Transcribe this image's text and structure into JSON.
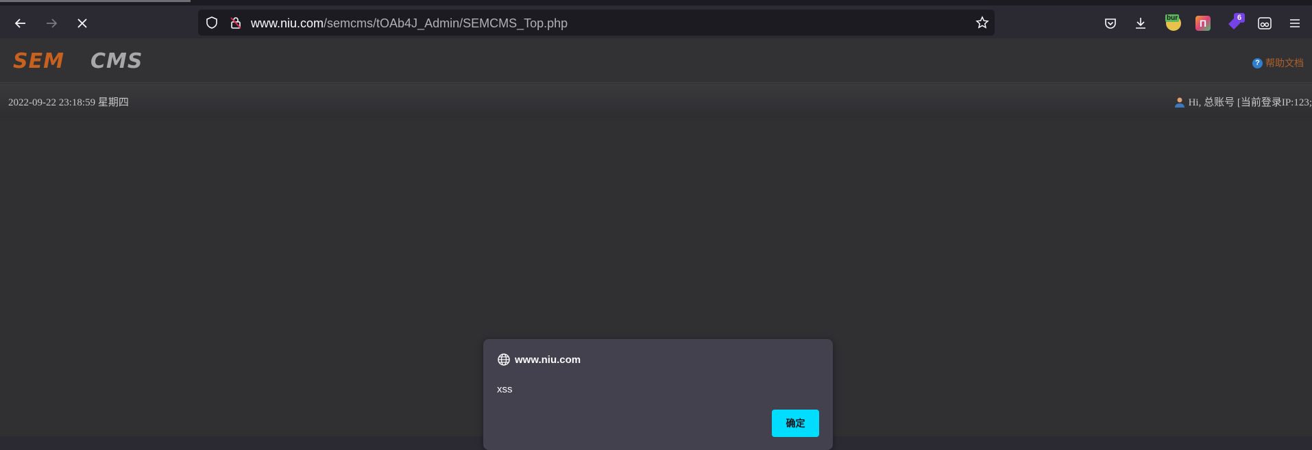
{
  "browser": {
    "url_domain": "www.niu.com",
    "url_path": "/semcms/tOAb4J_Admin/SEMCMS_Top.php",
    "extensions": [
      {
        "name": "bur",
        "color": "#e8c34b"
      },
      {
        "name": "n-ext",
        "color": "#f07a3a"
      },
      {
        "name": "tag-ext",
        "badge": "6",
        "color": "#7542e5"
      },
      {
        "name": "mask-ext",
        "color": "#ffffff"
      }
    ]
  },
  "site": {
    "logo_text": "SEMCMS",
    "help_label": "帮助文档",
    "datetime": "2022-09-22 23:18:59 星期四",
    "user_greeting": "Hi, 总账号 [当前登录IP:123;"
  },
  "dialog": {
    "origin": "www.niu.com",
    "message": "xss",
    "ok_label": "确定"
  },
  "colors": {
    "accent": "#00ddff",
    "logo_orange": "#c8601e",
    "logo_gray": "#a8a8a8"
  }
}
